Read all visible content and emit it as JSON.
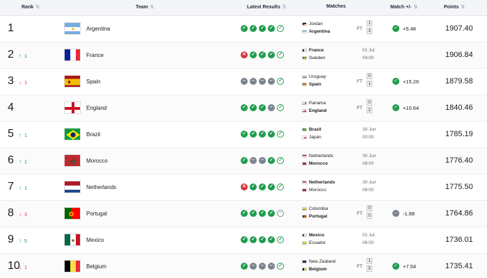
{
  "headers": {
    "rank": "Rank",
    "team": "Team",
    "latest_results": "Latest Results",
    "matches": "Matches",
    "match_delta": "Match +/-",
    "points": "Points",
    "sort_icon": "sort-icon"
  },
  "colors": {
    "win": "#1f9c4c",
    "draw": "#7d838c",
    "loss": "#d2343f",
    "up": "#1e9b4b",
    "down": "#d2343f"
  },
  "rows": [
    {
      "rank": "1",
      "move": "",
      "move_dir": "none",
      "team": "Argentina",
      "flag": "argentina-flag-icon",
      "results": [
        "W",
        "W",
        "W",
        "W",
        "W"
      ],
      "match": {
        "team1": "Jordan",
        "team2": "Argentina",
        "winner": 2,
        "status": "FT",
        "score1": "1",
        "score2": "3",
        "date": "",
        "time": ""
      },
      "delta": "+5.48",
      "delta_sign": "pos",
      "points": "1907.40"
    },
    {
      "rank": "2",
      "move": "1",
      "move_dir": "up",
      "team": "France",
      "flag": "france-flag-icon",
      "results": [
        "L",
        "W",
        "W",
        "W",
        "W"
      ],
      "match": {
        "team1": "France",
        "team2": "Sweden",
        "winner": 1,
        "status": "",
        "score1": "",
        "score2": "",
        "date": "01 Jul",
        "time": "04:00"
      },
      "delta": "",
      "delta_sign": "none",
      "points": "1906.84"
    },
    {
      "rank": "3",
      "move": "1",
      "move_dir": "down",
      "team": "Spain",
      "flag": "spain-flag-icon",
      "results": [
        "D",
        "D",
        "D",
        "D",
        "W"
      ],
      "match": {
        "team1": "Uruguay",
        "team2": "Spain",
        "winner": 2,
        "status": "FT",
        "score1": "0",
        "score2": "1",
        "date": "",
        "time": ""
      },
      "delta": "+15.26",
      "delta_sign": "pos",
      "points": "1879.58"
    },
    {
      "rank": "4",
      "move": "",
      "move_dir": "none",
      "team": "England",
      "flag": "england-flag-icon",
      "results": [
        "W",
        "W",
        "W",
        "D",
        "W"
      ],
      "match": {
        "team1": "Panama",
        "team2": "England",
        "winner": 2,
        "status": "FT",
        "score1": "0",
        "score2": "2",
        "date": "",
        "time": ""
      },
      "delta": "+10.64",
      "delta_sign": "pos",
      "points": "1840.46"
    },
    {
      "rank": "5",
      "move": "1",
      "move_dir": "up",
      "team": "Brazil",
      "flag": "brazil-flag-icon",
      "results": [
        "W",
        "W",
        "W",
        "W",
        "W"
      ],
      "match": {
        "team1": "Brazil",
        "team2": "Japan",
        "winner": 1,
        "status": "",
        "score1": "",
        "score2": "",
        "date": "30 Jun",
        "time": "00:00"
      },
      "delta": "",
      "delta_sign": "none",
      "points": "1785.19"
    },
    {
      "rank": "6",
      "move": "1",
      "move_dir": "up",
      "team": "Morocco",
      "flag": "morocco-flag-icon",
      "results": [
        "W",
        "D",
        "D",
        "W",
        "W"
      ],
      "match": {
        "team1": "Netherlands",
        "team2": "Morocco",
        "winner": 2,
        "status": "",
        "score1": "",
        "score2": "",
        "date": "30 Jun",
        "time": "08:00"
      },
      "delta": "",
      "delta_sign": "none",
      "points": "1776.40"
    },
    {
      "rank": "7",
      "move": "1",
      "move_dir": "up",
      "team": "Netherlands",
      "flag": "netherlands-flag-icon",
      "results": [
        "L",
        "W",
        "W",
        "W",
        "W"
      ],
      "match": {
        "team1": "Netherlands",
        "team2": "Morocco",
        "winner": 1,
        "status": "",
        "score1": "",
        "score2": "",
        "date": "30 Jun",
        "time": "08:00"
      },
      "delta": "",
      "delta_sign": "none",
      "points": "1775.50"
    },
    {
      "rank": "8",
      "move": "3",
      "move_dir": "down",
      "team": "Portugal",
      "flag": "portugal-flag-icon",
      "results": [
        "W",
        "W",
        "W",
        "W",
        "D"
      ],
      "match": {
        "team1": "Colombia",
        "team2": "Portugal",
        "winner": 2,
        "status": "FT",
        "score1": "0",
        "score2": "0",
        "date": "",
        "time": ""
      },
      "delta": "-1.88",
      "delta_sign": "neg",
      "points": "1764.86"
    },
    {
      "rank": "9",
      "move": "5",
      "move_dir": "up",
      "team": "Mexico",
      "flag": "mexico-flag-icon",
      "results": [
        "W",
        "W",
        "W",
        "W",
        "W"
      ],
      "match": {
        "team1": "Mexico",
        "team2": "Ecuador",
        "winner": 1,
        "status": "",
        "score1": "",
        "score2": "",
        "date": "01 Jul",
        "time": "06:00"
      },
      "delta": "",
      "delta_sign": "none",
      "points": "1736.01"
    },
    {
      "rank": "10",
      "move": "1",
      "move_dir": "down",
      "team": "Belgium",
      "flag": "belgium-flag-icon",
      "results": [
        "W",
        "D",
        "D",
        "D",
        "W"
      ],
      "match": {
        "team1": "New Zealand",
        "team2": "Belgium",
        "winner": 2,
        "status": "FT",
        "score1": "1",
        "score2": "5",
        "date": "",
        "time": ""
      },
      "delta": "+7.54",
      "delta_sign": "pos",
      "points": "1735.41"
    }
  ]
}
